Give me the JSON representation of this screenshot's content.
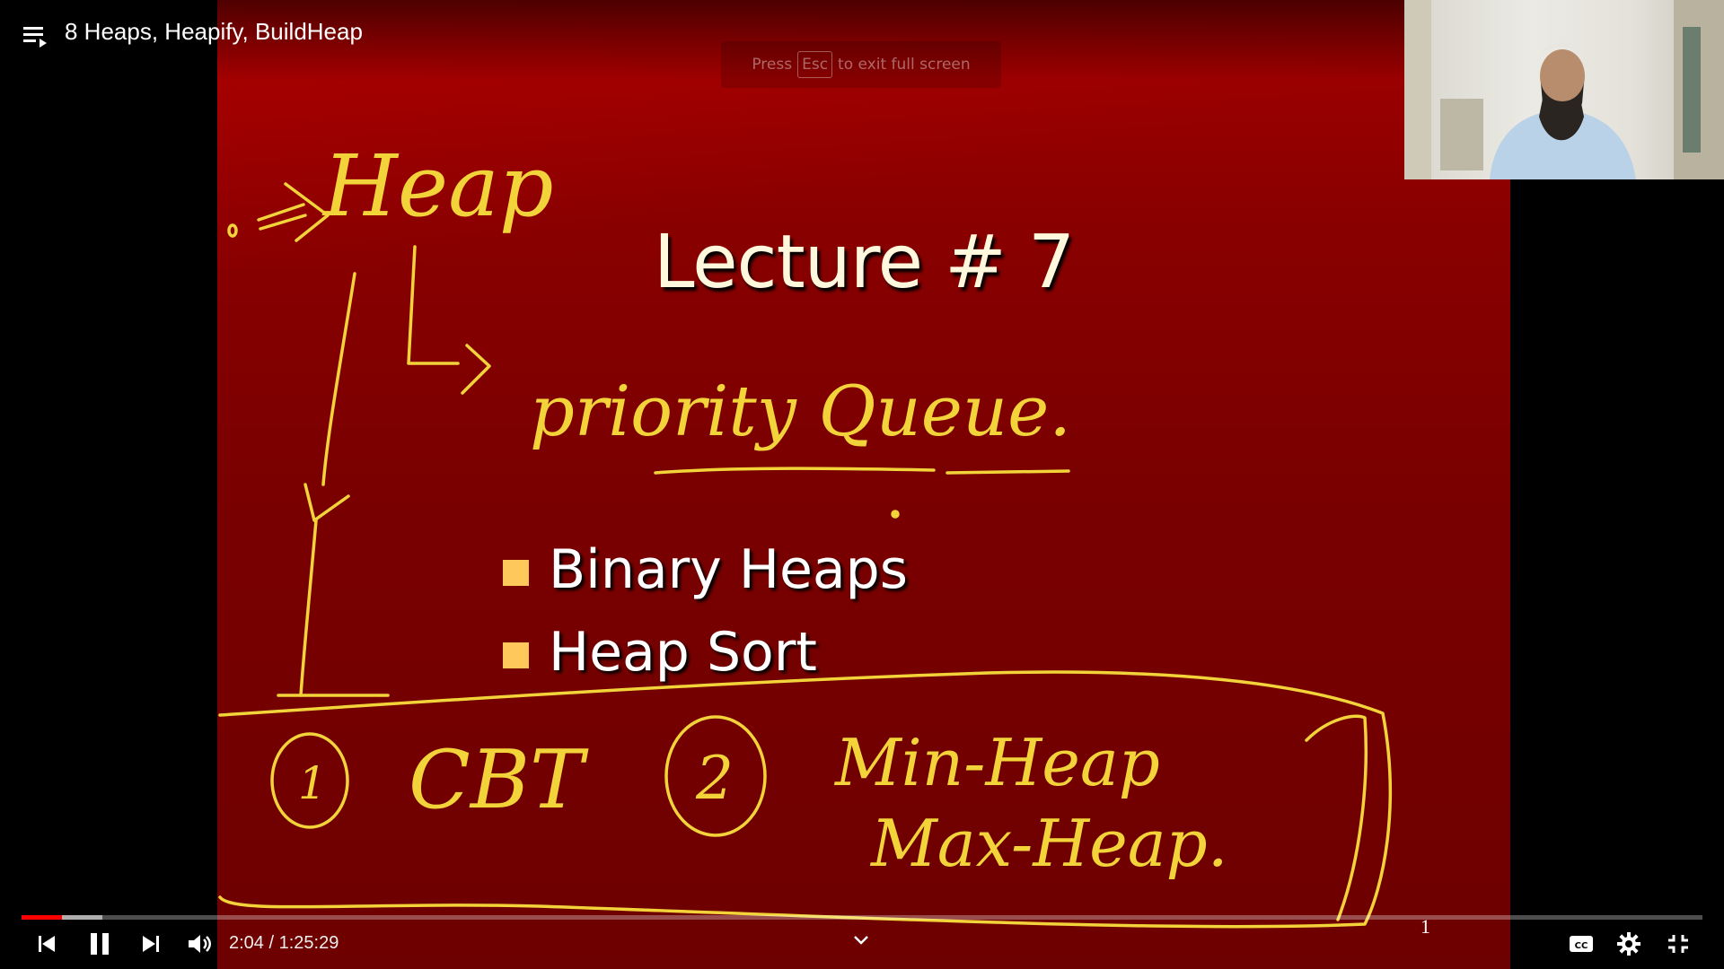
{
  "video": {
    "title": "8 Heaps, Heapify, BuildHeap"
  },
  "fullscreen_notice": {
    "press": "Press",
    "key": "Esc",
    "rest": "to exit full screen"
  },
  "slide": {
    "title": "Lecture # 7",
    "bullets": [
      "Binary Heaps",
      "Heap Sort"
    ],
    "page_number": "1",
    "bullet_color": "#ffc85a",
    "background": "#8a0000"
  },
  "annotations": {
    "color": "#f2d43a",
    "words": [
      "Heap",
      "priority Queue.",
      "CBT",
      "Min-Heap",
      "Max-Heap.",
      "1",
      "2"
    ]
  },
  "player": {
    "current_time": "2:04",
    "separator": "/",
    "duration": "1:25:29",
    "progress_fraction": 0.0242,
    "buffered_fraction": 0.048,
    "accent": "#ff0000",
    "icons": [
      "playlist-icon",
      "watch-later-icon",
      "share-icon",
      "previous-icon",
      "pause-icon",
      "next-icon",
      "volume-icon",
      "chevron-down-icon",
      "captions-icon",
      "settings-icon",
      "exit-fullscreen-icon"
    ]
  }
}
